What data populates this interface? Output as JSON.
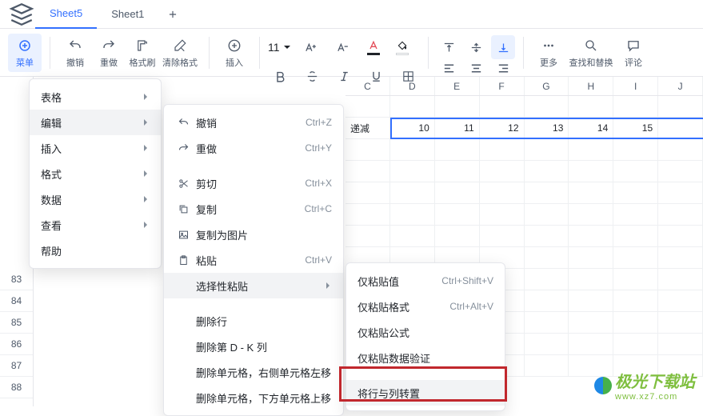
{
  "tabs": {
    "active": "Sheet5",
    "other": "Sheet1"
  },
  "toolbar": {
    "menu": "菜单",
    "undo": "撤销",
    "redo": "重做",
    "formatPainter": "格式刷",
    "clearFormat": "清除格式",
    "insert": "插入",
    "fontSize": "11",
    "more": "更多",
    "findReplace": "查找和替换",
    "comment": "评论"
  },
  "menu1": {
    "items": [
      "表格",
      "编辑",
      "插入",
      "格式",
      "数据",
      "查看",
      "帮助"
    ],
    "activeIndex": 1
  },
  "menu2": {
    "items": [
      {
        "icon": "undo",
        "label": "撤销",
        "shortcut": "Ctrl+Z"
      },
      {
        "icon": "redo",
        "label": "重做",
        "shortcut": "Ctrl+Y"
      },
      {
        "icon": "cut",
        "label": "剪切",
        "shortcut": "Ctrl+X"
      },
      {
        "icon": "copy",
        "label": "复制",
        "shortcut": "Ctrl+C"
      },
      {
        "icon": "image",
        "label": "复制为图片",
        "shortcut": ""
      },
      {
        "icon": "paste",
        "label": "粘贴",
        "shortcut": "Ctrl+V"
      },
      {
        "icon": "",
        "label": "选择性粘贴",
        "shortcut": "",
        "submenu": true,
        "hover": true
      },
      {
        "icon": "",
        "label": "删除行",
        "shortcut": ""
      },
      {
        "icon": "",
        "label": "删除第 D - K 列",
        "shortcut": ""
      },
      {
        "icon": "",
        "label": "删除单元格，右侧单元格左移",
        "shortcut": ""
      },
      {
        "icon": "",
        "label": "删除单元格，下方单元格上移",
        "shortcut": ""
      }
    ],
    "gapsAfter": [
      1,
      5,
      6
    ]
  },
  "menu3": {
    "items": [
      {
        "label": "仅粘贴值",
        "shortcut": "Ctrl+Shift+V"
      },
      {
        "label": "仅粘贴格式",
        "shortcut": "Ctrl+Alt+V"
      },
      {
        "label": "仅粘贴公式",
        "shortcut": ""
      },
      {
        "label": "仅粘贴数据验证",
        "shortcut": ""
      },
      {
        "label": "将行与列转置",
        "shortcut": "",
        "hover": true
      }
    ],
    "gapsAfter": [
      3
    ]
  },
  "rowHeaders": [
    "83",
    "84",
    "85",
    "86",
    "87",
    "88"
  ],
  "colHeaders": [
    "C",
    "D",
    "E",
    "F",
    "G",
    "H",
    "I",
    "J"
  ],
  "dataRow": {
    "label": "递减",
    "values": [
      10,
      11,
      12,
      13,
      14,
      15
    ]
  },
  "watermark": {
    "brand": "极光下载站",
    "url": "www.xz7.com"
  },
  "colors": {
    "accent": "#3370ff",
    "textred": "#e34d59",
    "textcolorbar": "#1f2329",
    "fillbar": "#ffffff"
  }
}
